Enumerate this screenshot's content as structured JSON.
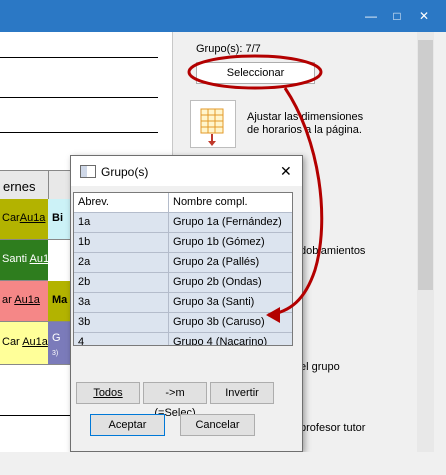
{
  "window": {
    "min_icon": "minimize-icon",
    "max_icon": "maximize-icon",
    "close_icon": "close-icon",
    "titlebar_color": "#2b78c5"
  },
  "timetable": {
    "day_header": "ernes",
    "rows": [
      {
        "left_text": "Car",
        "left_link": "Au1a",
        "left_color": "#b3b300",
        "right_text": "Bi",
        "right_color": "#ccf2f7"
      },
      {
        "left_text": "Santi ",
        "left_link": "Au1",
        "left_color": "#2e7d1e",
        "right_text": "",
        "right_color": "#ffffff"
      },
      {
        "left_text": "ar ",
        "left_link": "Au1a",
        "left_color": "#f58787",
        "right_text": "Ma",
        "right_color": "#b3b300"
      },
      {
        "left_text": "Car ",
        "left_link": "Au1a",
        "left_color": "#ffff99",
        "right_text": "G",
        "right_color": "#7b7bba",
        "right_sub": "3)"
      }
    ]
  },
  "right_panel": {
    "group_count": "Grupo(s): 7/7",
    "select_label": "Seleccionar",
    "adjust_label_1": "Ajustar las dimensiones",
    "adjust_label_2": "de horarios a la página.",
    "doubles_label": "doblamientos",
    "group_label": "el grupo",
    "tutor_label": "profesor tutor"
  },
  "dialog": {
    "title": "Grupo(s)",
    "close_icon": "close-icon",
    "columns": [
      "Abrev.",
      "Nombre compl."
    ],
    "rows": [
      [
        "1a",
        "Grupo 1a (Fernández)"
      ],
      [
        "1b",
        "Grupo 1b (Gómez)"
      ],
      [
        "2a",
        "Grupo 2a (Pallés)"
      ],
      [
        "2b",
        "Grupo 2b (Ondas)"
      ],
      [
        "3a",
        "Grupo 3a (Santi)"
      ],
      [
        "3b",
        "Grupo 3b (Caruso)"
      ],
      [
        "4",
        "Grupo 4 (Nacarino)"
      ]
    ],
    "btn_all": "Todos",
    "btn_m": "->m (=Selec)",
    "btn_invert": "Invertir",
    "btn_ok": "Aceptar",
    "btn_cancel": "Cancelar"
  },
  "annotation_color": "#b30000"
}
